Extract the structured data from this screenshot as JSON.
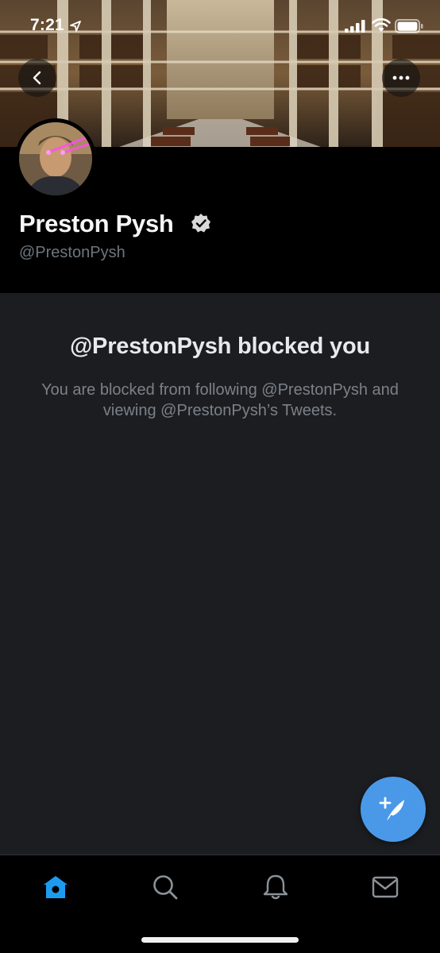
{
  "status_bar": {
    "time": "7:21"
  },
  "profile": {
    "display_name": "Preston Pysh",
    "handle": "@PrestonPysh",
    "verified": true
  },
  "blocked": {
    "title": "@PrestonPysh blocked you",
    "message": "You are blocked from following @PrestonPysh and viewing @PrestonPysh’s Tweets."
  },
  "icons": {
    "back": "chevron-left-icon",
    "more": "more-horizontal-icon",
    "compose": "compose-tweet-icon",
    "home": "home-icon",
    "search": "search-icon",
    "notifications": "bell-icon",
    "messages": "mail-icon"
  },
  "colors": {
    "accent": "#1d9bf0",
    "fab": "#4a99e9",
    "background": "#1b1d21",
    "header_background": "#000000",
    "secondary_text": "#6e767d"
  }
}
